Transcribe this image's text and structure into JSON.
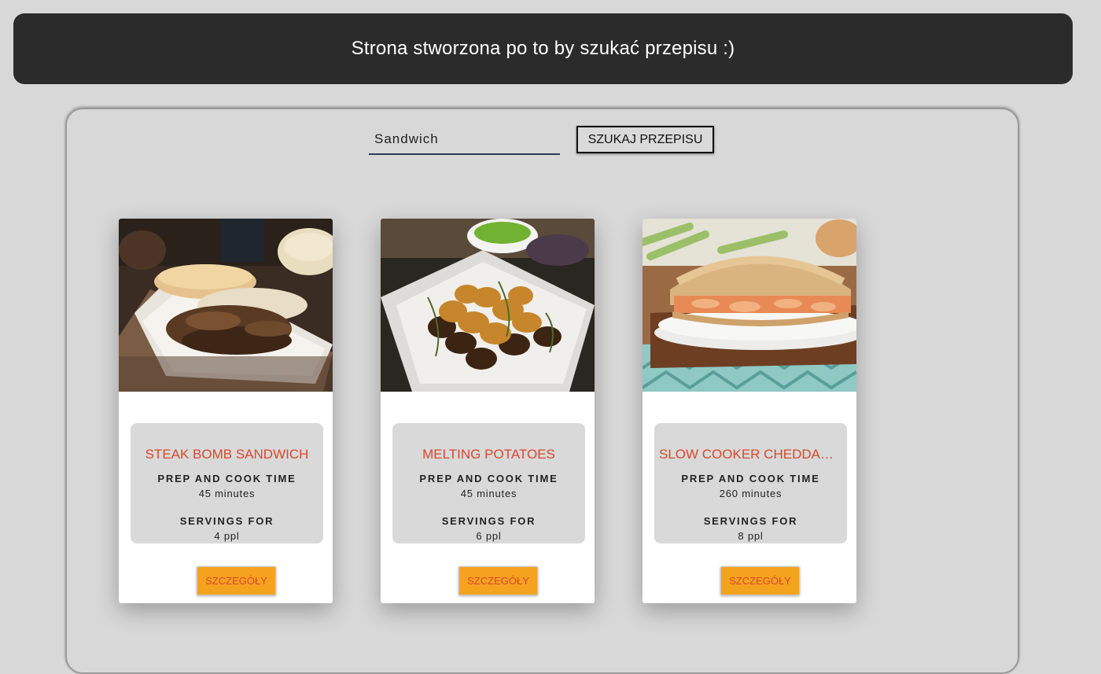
{
  "header": {
    "title": "Strona stworzona po to by szukać przepisu :)"
  },
  "search": {
    "value": "Sandwich",
    "button_label": "SZUKAJ PRZEPISU"
  },
  "cards": [
    {
      "title": "STEAK BOMB SANDWICH",
      "time_label": "PREP AND COOK TIME",
      "time_value": "45 minutes",
      "servings_label": "SERVINGS FOR",
      "servings_value": "4 ppl",
      "button_label": "SZCZEGÓŁY"
    },
    {
      "title": "MELTING POTATOES",
      "time_label": "PREP AND COOK TIME",
      "time_value": "45 minutes",
      "servings_label": "SERVINGS FOR",
      "servings_value": "6 ppl",
      "button_label": "SZCZEGÓŁY"
    },
    {
      "title": "SLOW COOKER CHEDDAR ...",
      "time_label": "PREP AND COOK TIME",
      "time_value": "260 minutes",
      "servings_label": "SERVINGS FOR",
      "servings_value": "8 ppl",
      "button_label": "SZCZEGÓŁY"
    }
  ],
  "colors": {
    "background": "#d8d8d8",
    "header": "#2b2b2b",
    "title_accent": "#d9472d",
    "button_accent": "#f5a31f"
  }
}
